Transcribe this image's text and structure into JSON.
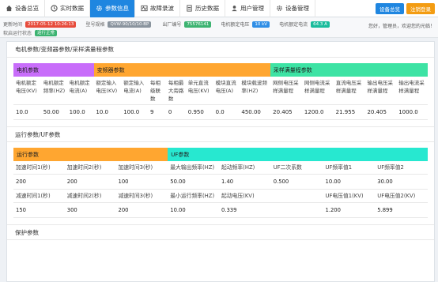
{
  "nav": {
    "tabs": [
      {
        "label": "设备总览",
        "icon": "home-icon"
      },
      {
        "label": "实时数据",
        "icon": "clock-icon"
      },
      {
        "label": "参数信息",
        "icon": "gear-icon"
      },
      {
        "label": "故障录波",
        "icon": "wave-icon"
      },
      {
        "label": "历史数据",
        "icon": "document-icon"
      },
      {
        "label": "用户管理",
        "icon": "user-icon"
      },
      {
        "label": "设备管理",
        "icon": "gear-icon"
      }
    ],
    "active_index": 2,
    "btn_blue": "设备总览",
    "btn_orange": "注销登录"
  },
  "status": {
    "update_label": "更新时间",
    "update_time": "2017-05-12 10:26:13",
    "model_label": "型号规格",
    "model_value": "QVW-90/10/10-BP",
    "serial_label": "出厂编号",
    "serial_value": "75576141",
    "voltage_label": "电机额定电压",
    "voltage_value": "10 kV",
    "current_label": "电机额定电流",
    "current_value": "64.3 A",
    "run_label": "软启运行状态",
    "run_value": "运行正常",
    "welcome": "您好，管理员，欢迎您的光临！"
  },
  "sec1": {
    "title": "电机参数/变频器参数/采样满量程参数",
    "groups": [
      "电机参数",
      "变频器参数",
      "采样满量程参数"
    ],
    "labels": [
      "电机额定电压(KV)",
      "电机额定频率(HZ)",
      "电机额定电流(A)",
      "额定输入电压(KV)",
      "额定输入电流(A)",
      "每相级联数",
      "每相最大旁路数",
      "单元直流电压(KV)",
      "模块直流电压(A)",
      "模块载波频率(HZ)",
      "网侧电压采样满量程",
      "网侧电流采样满量程",
      "直流电压采样满量程",
      "输出电压采样满量程",
      "输出电流采样满量程"
    ],
    "values": [
      "10.0",
      "50.00",
      "100.0",
      "10.0",
      "100.0",
      "9",
      "0",
      "0.950",
      "0.0",
      "450.00",
      "20.405",
      "1200.0",
      "21.955",
      "20.405",
      "1000.0"
    ]
  },
  "sec2": {
    "title": "运行参数/UF参数",
    "groups": [
      "运行参数",
      "UF参数"
    ],
    "row1_labels": [
      "加速时间1(秒)",
      "加速时间2(秒)",
      "加速时间3(秒)",
      "最大输出频率(HZ)",
      "起动频率(HZ)",
      "UF二次系数",
      "UF频率值1",
      "UF频率值2"
    ],
    "row1_values": [
      "200",
      "200",
      "100",
      "50.00",
      "1.40",
      "0.500",
      "10.00",
      "30.00"
    ],
    "row2_labels": [
      "减速时间1(秒)",
      "减速时间2(秒)",
      "减速时间3(秒)",
      "最小运行频率(HZ)",
      "起动电压(KV)",
      "",
      "UF电压值1(KV)",
      "UF电压值2(KV)"
    ],
    "row2_values": [
      "150",
      "300",
      "200",
      "10.00",
      "0.339",
      "",
      "1.200",
      "5.899"
    ]
  },
  "sec3": {
    "title": "保护参数"
  },
  "colors": {
    "accent": "#1f86e0",
    "purple": "#c86dfa",
    "orange": "#ffa630",
    "green": "#3de3a4",
    "cyan": "#27e8d0"
  }
}
